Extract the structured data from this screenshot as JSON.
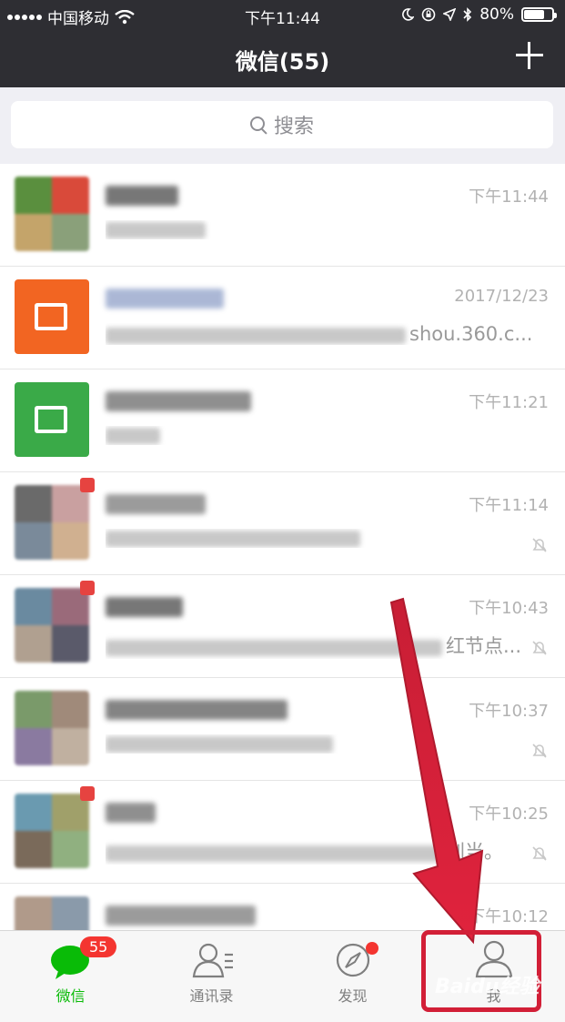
{
  "status_bar": {
    "carrier": "中国移动",
    "time": "下午11:44",
    "battery": "80%",
    "battery_level": 0.8
  },
  "nav": {
    "title": "微信(55)",
    "add_icon": "plus-icon"
  },
  "search": {
    "placeholder": "搜索",
    "icon": "search-icon"
  },
  "chats": [
    {
      "time": "下午11:44",
      "preview_tail": "",
      "muted": false,
      "avatar_colors": [
        "#5a8f3e",
        "#d94a3a",
        "#c4a46a",
        "#8aa07a"
      ]
    },
    {
      "time": "2017/12/23",
      "preview_tail": "shou.360.c...",
      "muted": false,
      "avatar_colors": [
        "#f26522",
        "#ffffff"
      ]
    },
    {
      "time": "下午11:21",
      "preview_tail": "",
      "muted": false,
      "avatar_colors": [
        "#3aaa48",
        "#ffffff"
      ]
    },
    {
      "time": "下午11:14",
      "preview_tail": "",
      "muted": true,
      "avatar_colors": [
        "#6a6a6a",
        "#c9a0a0",
        "#7a8a9a",
        "#d0b090"
      ]
    },
    {
      "time": "下午10:43",
      "preview_tail": "红节点...",
      "muted": true,
      "avatar_colors": [
        "#6a8aa0",
        "#9a6a7a",
        "#b0a090",
        "#5a5a6a"
      ]
    },
    {
      "time": "下午10:37",
      "preview_tail": "",
      "muted": true,
      "avatar_colors": [
        "#7a9a6a",
        "#a08a7a",
        "#8a7aa0",
        "#c0b0a0"
      ]
    },
    {
      "time": "下午10:25",
      "preview_tail": "别当。",
      "muted": true,
      "avatar_colors": [
        "#6a9ab0",
        "#a0a06a",
        "#7a6a5a",
        "#90b080"
      ]
    },
    {
      "time": "下午10:12",
      "preview_tail": "",
      "muted": false,
      "avatar_colors": [
        "#b09a8a",
        "#8a9aaa",
        "#a07a6a",
        "#c0c0b0"
      ]
    }
  ],
  "tabs": [
    {
      "label": "微信",
      "icon": "chat-bubble-icon",
      "badge": "55",
      "active": true
    },
    {
      "label": "通讯录",
      "icon": "contacts-icon",
      "active": false
    },
    {
      "label": "发现",
      "icon": "compass-icon",
      "dot": true,
      "active": false
    },
    {
      "label": "我",
      "icon": "person-icon",
      "active": false
    }
  ],
  "colors": {
    "header_bg": "#2e2e33",
    "accent_green": "#09bb07",
    "badge_red": "#f43530",
    "annotation_red": "#d21f37"
  },
  "watermark": "Baidu经验"
}
